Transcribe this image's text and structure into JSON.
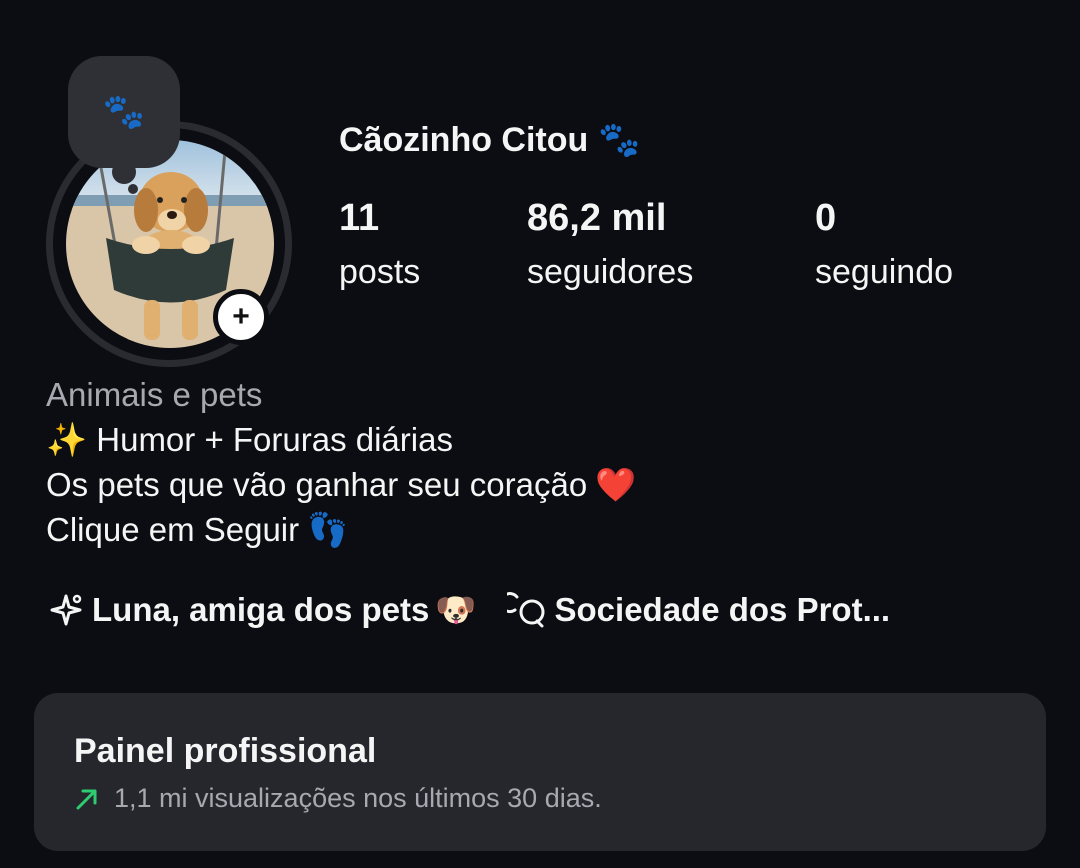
{
  "profile": {
    "note_emoji": "🐾",
    "username": "Cãozinho Citou",
    "username_emoji": "🐾",
    "add_story_symbol": "+"
  },
  "stats": {
    "posts": {
      "value": "11",
      "label": "posts"
    },
    "followers": {
      "value": "86,2 mil",
      "label": "seguidores"
    },
    "following": {
      "value": "0",
      "label": "seguindo"
    }
  },
  "bio": {
    "category": "Animais e pets",
    "line1": "✨ Humor + Foruras diárias",
    "line2": "Os pets que vão ganhar seu coração",
    "line2_emoji": "❤️",
    "line3": "Clique em Seguir",
    "line3_emoji": "👣"
  },
  "links": {
    "ai_label": "Luna, amiga dos pets",
    "ai_emoji": "🐶",
    "channel_label": "Sociedade dos Prot..."
  },
  "dashboard": {
    "title": "Painel profissional",
    "subtitle": "1,1 mi visualizações nos últimos 30 dias.",
    "trend_color": "#2ecc71"
  },
  "colors": {
    "background": "#0c0d12",
    "card": "#26272d",
    "muted_text": "#a8a8b0"
  }
}
